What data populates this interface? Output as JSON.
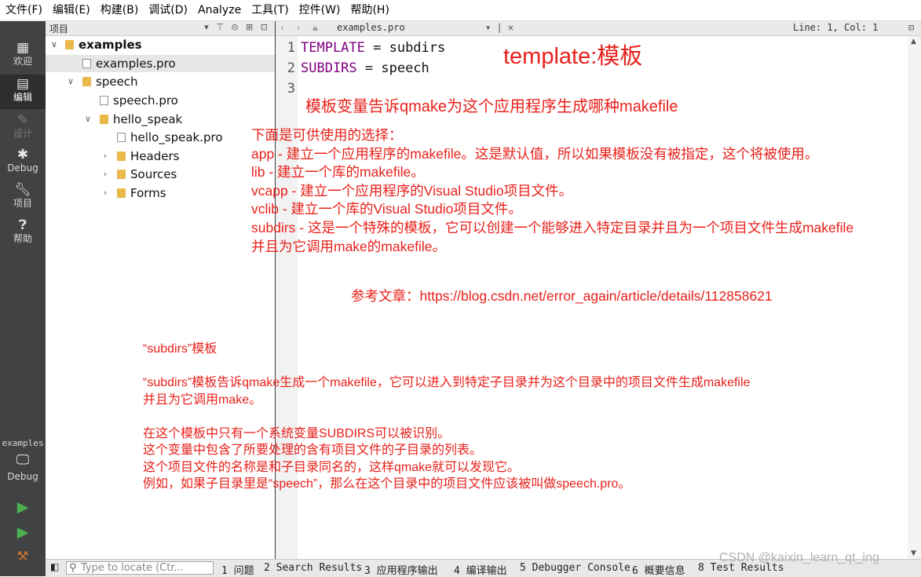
{
  "menubar": {
    "items": [
      "文件(F)",
      "编辑(E)",
      "构建(B)",
      "调试(D)",
      "Analyze",
      "工具(T)",
      "控件(W)",
      "帮助(H)"
    ]
  },
  "modebar": {
    "welcome": "欢迎",
    "edit": "编辑",
    "design": "设计",
    "debug": "Debug",
    "projects": "项目",
    "help": "帮助",
    "kit_name": "examples",
    "kit_mode": "Debug"
  },
  "project_pane": {
    "title": "项目",
    "tree": [
      {
        "label": "examples",
        "arrow": "∨",
        "icon": "project-folder-icon",
        "bold": true
      },
      {
        "label": "examples.pro",
        "arrow": "",
        "icon": "pro-file-icon",
        "selected": true
      },
      {
        "label": "speech",
        "arrow": "∨",
        "icon": "folder-icon"
      },
      {
        "label": "speech.pro",
        "arrow": "",
        "icon": "pro-file-icon"
      },
      {
        "label": "hello_speak",
        "arrow": "∨",
        "icon": "folder-icon"
      },
      {
        "label": "hello_speak.pro",
        "arrow": "",
        "icon": "pro-file-icon"
      },
      {
        "label": "Headers",
        "arrow": "›",
        "icon": "headers-folder-icon"
      },
      {
        "label": "Sources",
        "arrow": "›",
        "icon": "sources-folder-icon"
      },
      {
        "label": "Forms",
        "arrow": "›",
        "icon": "forms-folder-icon"
      }
    ]
  },
  "editor_toolbar": {
    "file_name": "examples.pro",
    "position": "Line: 1, Col: 1"
  },
  "editor": {
    "line_numbers": [
      "1",
      "2",
      "3"
    ],
    "lines": [
      {
        "keyword": "TEMPLATE",
        "rest": " = subdirs"
      },
      {
        "keyword": "SUBDIRS",
        "rest": " = speech"
      }
    ]
  },
  "annotations": {
    "title": "template:模板",
    "subtitle": "模板变量告诉qmake为这个应用程序生成哪种makefile",
    "choices": [
      "下面是可供使用的选择：",
      "app - 建立一个应用程序的makefile。这是默认值，所以如果模板没有被指定，这个将被使用。",
      "lib - 建立一个库的makefile。",
      "vcapp - 建立一个应用程序的Visual Studio项目文件。",
      "vclib - 建立一个库的Visual Studio项目文件。",
      "subdirs - 这是一个特殊的模板，它可以创建一个能够进入特定目录并且为一个项目文件生成makefile",
      "并且为它调用make的makefile。"
    ],
    "reference": "参考文章：https://blog.csdn.net/error_again/article/details/112858621",
    "subdirs_notes": [
      "“subdirs”模板",
      "“subdirs”模板告诉qmake生成一个makefile，它可以进入到特定子目录并为这个目录中的项目文件生成makefile",
      "并且为它调用make。",
      "在这个模板中只有一个系统变量SUBDIRS可以被识别。",
      "这个变量中包含了所要处理的含有项目文件的子目录的列表。",
      "这个项目文件的名称是和子目录同名的，这样qmake就可以发现它。",
      "例如，如果子目录里是“speech”，那么在这个目录中的项目文件应该被叫做speech.pro。"
    ]
  },
  "statusbar": {
    "locate_placeholder": "Type to locate (Ctr...",
    "tabs": [
      "1 问题",
      "2 Search Results",
      "3 应用程序输出",
      "4 编译输出",
      "5 Debugger Console",
      "6 概要信息",
      "8 Test Results"
    ]
  },
  "watermark": "CSDN @kaixin_learn_qt_ing",
  "colors": {
    "annotation": "#e8211b",
    "keyword": "#800080",
    "modebar": "#404244"
  }
}
